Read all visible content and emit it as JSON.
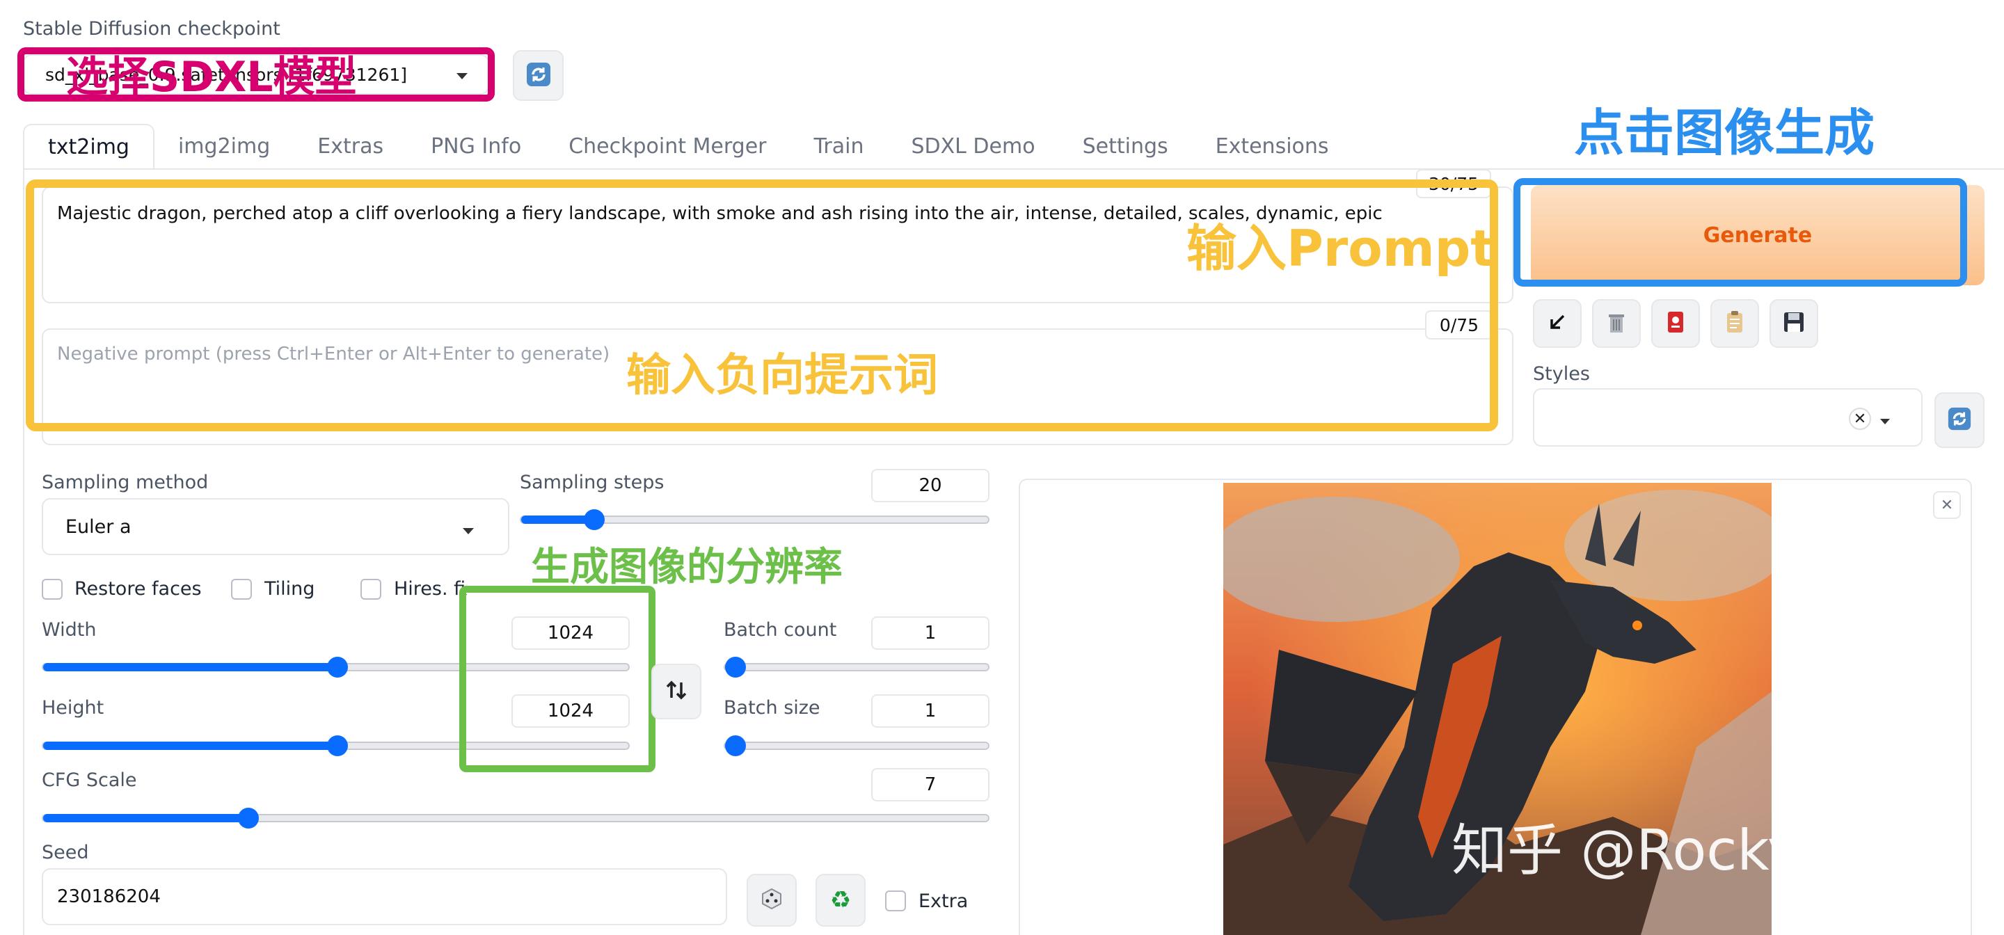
{
  "checkpoint": {
    "label": "Stable Diffusion checkpoint",
    "value": "sd_xl_base_0.9.safetensors [1f69731261]"
  },
  "tabs": [
    "txt2img",
    "img2img",
    "Extras",
    "PNG Info",
    "Checkpoint Merger",
    "Train",
    "SDXL Demo",
    "Settings",
    "Extensions"
  ],
  "prompt": {
    "value": "Majestic dragon, perched atop a cliff overlooking a fiery landscape, with smoke and ash rising into the air, intense, detailed, scales, dynamic, epic",
    "counter": "30/75"
  },
  "negative_prompt": {
    "placeholder": "Negative prompt (press Ctrl+Enter or Alt+Enter to generate)",
    "counter": "0/75"
  },
  "generate_label": "Generate",
  "styles_label": "Styles",
  "sampling": {
    "method_label": "Sampling method",
    "method_value": "Euler a",
    "steps_label": "Sampling steps",
    "steps_value": "20",
    "steps_fraction": 0.14
  },
  "checks": {
    "restore_faces": "Restore faces",
    "tiling": "Tiling",
    "hires_fix": "Hires. fix"
  },
  "width": {
    "label": "Width",
    "value": "1024",
    "fraction": 0.5
  },
  "height": {
    "label": "Height",
    "value": "1024",
    "fraction": 0.5
  },
  "batch_count": {
    "label": "Batch count",
    "value": "1",
    "fraction": 0.0
  },
  "batch_size": {
    "label": "Batch size",
    "value": "1",
    "fraction": 0.0
  },
  "cfg": {
    "label": "CFG Scale",
    "value": "7",
    "fraction": 0.21
  },
  "seed": {
    "label": "Seed",
    "value": "230186204",
    "extra_label": "Extra"
  },
  "annotations": {
    "select_model": "选择SDXL模型",
    "click_generate": "点击图像生成",
    "input_prompt": "输入Prompt",
    "input_negative": "输入负向提示词",
    "resolution": "生成图像的分辨率"
  },
  "watermark": "知乎 @Rocky Ding",
  "icons": {
    "refresh": "refresh-icon",
    "arrow": "arrow-down-left-icon",
    "trash": "trash-icon",
    "card": "red-card-icon",
    "clipboard": "clipboard-icon",
    "save": "save-icon",
    "swap": "swap-icon",
    "dice": "dice-icon",
    "recycle": "recycle-icon",
    "close": "close-icon"
  },
  "colors": {
    "accent": "#0a6cff",
    "generate_text": "#e8590c",
    "anno_magenta": "#d6006f",
    "anno_blue": "#2b8ff0",
    "anno_yellow": "#f8c23a",
    "anno_green": "#6cc04a"
  }
}
